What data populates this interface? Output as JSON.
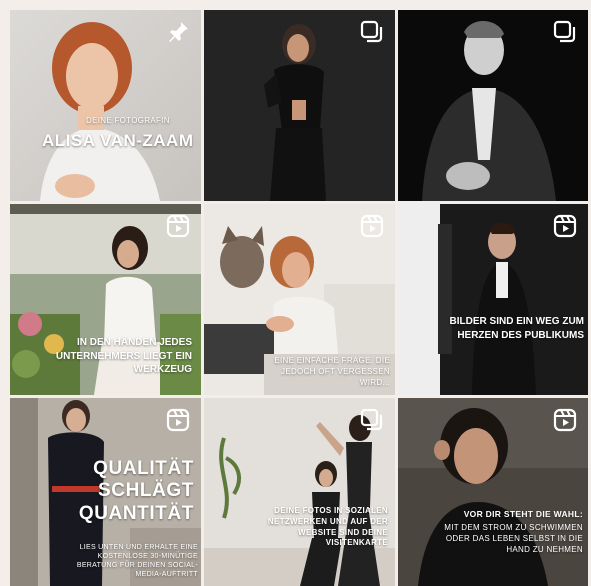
{
  "tiles": [
    {
      "id": "t1",
      "icon": "pin-icon",
      "subtitle": "DEINE FOTOGRAFIN",
      "title": "ALISA VAN-ZAAM"
    },
    {
      "id": "t2",
      "icon": "carousel-icon"
    },
    {
      "id": "t3",
      "icon": "carousel-icon"
    },
    {
      "id": "t4",
      "icon": "reel-icon",
      "caption": "IN DEN HÄNDEN JEDES UNTERNEHMERS LIEGT EIN WERKZEUG"
    },
    {
      "id": "t5",
      "icon": "reel-icon",
      "caption": "EINE EINFACHE FRAGE, DIE JEDOCH OFT VERGESSEN WIRD..."
    },
    {
      "id": "t6",
      "icon": "reel-icon",
      "caption": "BILDER SIND EIN WEG ZUM HERZEN DES PUBLIKUMS"
    },
    {
      "id": "t7",
      "icon": "reel-icon",
      "caption_line1": "QUALITÄT",
      "caption_line2": "SCHLÄGT",
      "caption_line3": "QUANTITÄT",
      "subcaption": "LIES UNTEN UND ERHALTE EINE KOSTENLOSE 30-MINÜTIGE BERATUNG FÜR DEINEN SOCIAL-MEDIA-AUFTRITT"
    },
    {
      "id": "t8",
      "icon": "carousel-icon",
      "caption": "DEINE FOTOS IN SOZIALEN NETZWERKEN UND AUF DER WEBSITE SIND DEINE VISITENKARTE"
    },
    {
      "id": "t9",
      "icon": "reel-icon",
      "caption": "VOR DIR STEHT DIE WAHL:",
      "subcaption": "MIT DEM STROM ZU SCHWIMMEN ODER DAS LEBEN SELBST IN DIE HAND ZU NEHMEN"
    }
  ]
}
